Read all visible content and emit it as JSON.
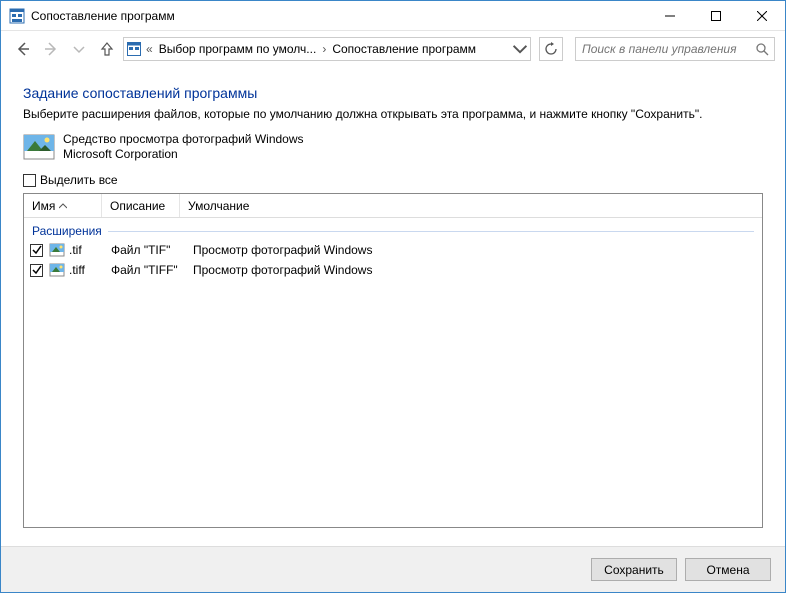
{
  "window": {
    "title": "Сопоставление программ"
  },
  "breadcrumb": {
    "prefix": "«",
    "seg1": "Выбор программ по умолч...",
    "seg2": "Сопоставление программ"
  },
  "search": {
    "placeholder": "Поиск в панели управления"
  },
  "heading": "Задание сопоставлений программы",
  "subtext": "Выберите расширения файлов, которые по умолчанию должна открывать эта программа, и нажмите кнопку \"Сохранить\".",
  "app": {
    "name": "Средство просмотра фотографий Windows",
    "publisher": "Microsoft Corporation"
  },
  "selectAllLabel": "Выделить все",
  "columns": {
    "name": "Имя",
    "desc": "Описание",
    "def": "Умолчание"
  },
  "group": "Расширения",
  "rows": [
    {
      "checked": true,
      "ext": ".tif",
      "desc": "Файл \"TIF\"",
      "def": "Просмотр фотографий Windows"
    },
    {
      "checked": true,
      "ext": ".tiff",
      "desc": "Файл \"TIFF\"",
      "def": "Просмотр фотографий Windows"
    }
  ],
  "buttons": {
    "save": "Сохранить",
    "cancel": "Отмена"
  }
}
